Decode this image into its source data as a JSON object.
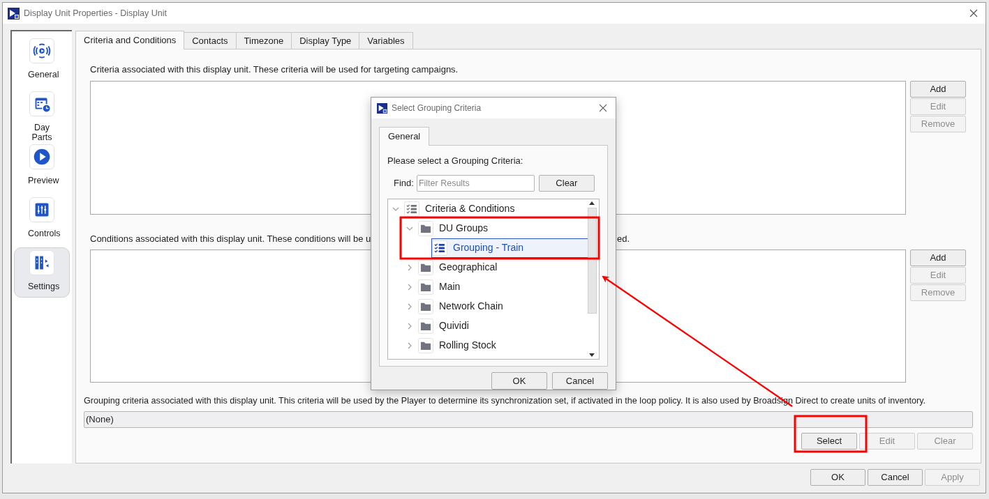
{
  "window": {
    "title": "Display Unit Properties - Display Unit"
  },
  "sidebar": {
    "items": [
      {
        "label": "General",
        "selected": false
      },
      {
        "label": "Day Parts",
        "selected": false
      },
      {
        "label": "Preview",
        "selected": false
      },
      {
        "label": "Controls",
        "selected": false
      },
      {
        "label": "Settings",
        "selected": true
      }
    ]
  },
  "tabs": [
    {
      "label": "Criteria and Conditions",
      "selected": true
    },
    {
      "label": "Contacts",
      "selected": false
    },
    {
      "label": "Timezone",
      "selected": false
    },
    {
      "label": "Display Type",
      "selected": false
    },
    {
      "label": "Variables",
      "selected": false
    }
  ],
  "criteria_section": {
    "description": "Criteria associated with this display unit. These criteria will be used for targeting campaigns.",
    "buttons": [
      {
        "label": "Add",
        "disabled": false
      },
      {
        "label": "Edit",
        "disabled": true
      },
      {
        "label": "Remove",
        "disabled": true
      }
    ]
  },
  "conditions_section": {
    "description_parts": [
      "Conditions associated with this display unit. These conditions will be u",
      "ed."
    ],
    "buttons": [
      {
        "label": "Add",
        "disabled": false
      },
      {
        "label": "Edit",
        "disabled": true
      },
      {
        "label": "Remove",
        "disabled": true
      }
    ]
  },
  "grouping_section": {
    "description": "Grouping criteria associated with this display unit. This criteria will be used by the Player to determine its synchronization set, if activated in the loop policy. It is also used by Broadsign Direct to create units of inventory.",
    "value": "(None)",
    "buttons": [
      {
        "label": "Select",
        "disabled": false
      },
      {
        "label": "Edit",
        "disabled": true
      },
      {
        "label": "Clear",
        "disabled": true
      }
    ]
  },
  "footer_buttons": [
    {
      "label": "OK",
      "disabled": false
    },
    {
      "label": "Cancel",
      "disabled": false
    },
    {
      "label": "Apply",
      "disabled": true
    }
  ],
  "dialog": {
    "title": "Select Grouping Criteria",
    "tab": {
      "label": "General",
      "selected": true
    },
    "prompt": "Please select a Grouping Criteria:",
    "find_label": "Find:",
    "find_placeholder": "Filter Results",
    "clear_button": "Clear",
    "tree": [
      {
        "label": "Criteria & Conditions",
        "kind": "list",
        "expanded": true,
        "selected": false,
        "children": [
          {
            "label": "DU Groups",
            "kind": "folder",
            "expanded": true,
            "selected": false,
            "children": [
              {
                "label": "Grouping - Train",
                "kind": "list",
                "selected": true
              }
            ]
          },
          {
            "label": "Geographical",
            "kind": "folder",
            "expanded": false,
            "selected": false
          },
          {
            "label": "Main",
            "kind": "folder",
            "expanded": false,
            "selected": false
          },
          {
            "label": "Network Chain",
            "kind": "folder",
            "expanded": false,
            "selected": false
          },
          {
            "label": "Quividi",
            "kind": "folder",
            "expanded": false,
            "selected": false
          },
          {
            "label": "Rolling Stock",
            "kind": "folder",
            "expanded": false,
            "selected": false
          }
        ]
      }
    ],
    "buttons": [
      "OK",
      "Cancel"
    ]
  },
  "annotations": [
    {
      "kind": "box"
    },
    {
      "kind": "box"
    },
    {
      "kind": "arrow"
    }
  ]
}
